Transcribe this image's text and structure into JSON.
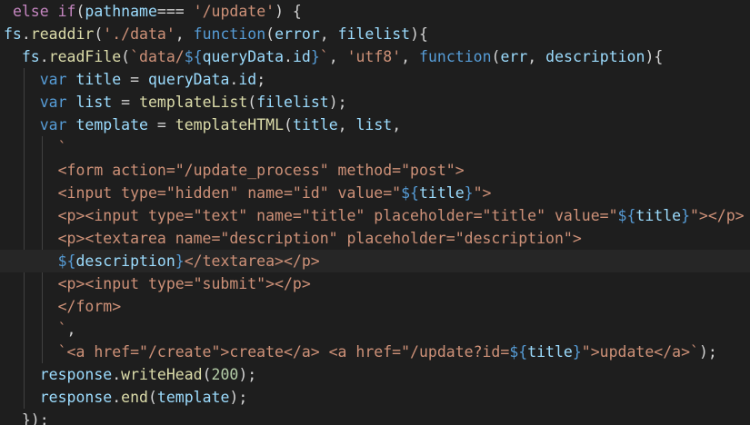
{
  "theme": {
    "background": "#1e1e1e",
    "current_line": "#262626",
    "indent_guide": "#404040",
    "colors": {
      "keyword": "#c586c0",
      "storage": "#569cd6",
      "function": "#dcdcaa",
      "variable": "#9cdcfe",
      "string": "#ce9178",
      "number": "#b5cea8",
      "punctuation": "#d4d4d4"
    }
  },
  "lines": [
    [
      [
        "pn",
        " "
      ],
      [
        "kw",
        "else if"
      ],
      [
        "pn",
        "("
      ],
      [
        "vr",
        "pathname"
      ],
      [
        "pn",
        "=== "
      ],
      [
        "str",
        "'/update'"
      ],
      [
        "pn",
        ") {"
      ]
    ],
    [
      [
        "vr",
        "fs"
      ],
      [
        "pn",
        "."
      ],
      [
        "fn",
        "readdir"
      ],
      [
        "pn",
        "("
      ],
      [
        "str",
        "'./data'"
      ],
      [
        "pn",
        ", "
      ],
      [
        "st",
        "function"
      ],
      [
        "pn",
        "("
      ],
      [
        "vr",
        "error"
      ],
      [
        "pn",
        ", "
      ],
      [
        "vr",
        "filelist"
      ],
      [
        "pn",
        "){"
      ]
    ],
    [
      [
        "pn",
        "  "
      ],
      [
        "vr",
        "fs"
      ],
      [
        "pn",
        "."
      ],
      [
        "fn",
        "readFile"
      ],
      [
        "pn",
        "("
      ],
      [
        "str",
        "`data/"
      ],
      [
        "tpl",
        "${"
      ],
      [
        "vr",
        "queryData"
      ],
      [
        "pn",
        "."
      ],
      [
        "vr",
        "id"
      ],
      [
        "tpl",
        "}"
      ],
      [
        "str",
        "`"
      ],
      [
        "pn",
        ", "
      ],
      [
        "str",
        "'utf8'"
      ],
      [
        "pn",
        ", "
      ],
      [
        "st",
        "function"
      ],
      [
        "pn",
        "("
      ],
      [
        "vr",
        "err"
      ],
      [
        "pn",
        ", "
      ],
      [
        "vr",
        "description"
      ],
      [
        "pn",
        "){"
      ]
    ],
    [
      [
        "pn",
        "    "
      ],
      [
        "st",
        "var"
      ],
      [
        "pn",
        " "
      ],
      [
        "vr",
        "title"
      ],
      [
        "pn",
        " = "
      ],
      [
        "vr",
        "queryData"
      ],
      [
        "pn",
        "."
      ],
      [
        "vr",
        "id"
      ],
      [
        "pn",
        ";"
      ]
    ],
    [
      [
        "pn",
        "    "
      ],
      [
        "st",
        "var"
      ],
      [
        "pn",
        " "
      ],
      [
        "vr",
        "list"
      ],
      [
        "pn",
        " = "
      ],
      [
        "fn",
        "templateList"
      ],
      [
        "pn",
        "("
      ],
      [
        "vr",
        "filelist"
      ],
      [
        "pn",
        ");"
      ]
    ],
    [
      [
        "pn",
        "    "
      ],
      [
        "st",
        "var"
      ],
      [
        "pn",
        " "
      ],
      [
        "vr",
        "template"
      ],
      [
        "pn",
        " = "
      ],
      [
        "fn",
        "templateHTML"
      ],
      [
        "pn",
        "("
      ],
      [
        "vr",
        "title"
      ],
      [
        "pn",
        ", "
      ],
      [
        "vr",
        "list"
      ],
      [
        "pn",
        ","
      ]
    ],
    [
      [
        "pn",
        "      "
      ],
      [
        "str",
        "`"
      ]
    ],
    [
      [
        "pn",
        "      "
      ],
      [
        "str",
        "<form action=\"/update_process\" method=\"post\">"
      ]
    ],
    [
      [
        "pn",
        "      "
      ],
      [
        "str",
        "<input type=\"hidden\" name=\"id\" value=\""
      ],
      [
        "tpl",
        "${"
      ],
      [
        "vr",
        "title"
      ],
      [
        "tpl",
        "}"
      ],
      [
        "str",
        "\">"
      ]
    ],
    [
      [
        "pn",
        "      "
      ],
      [
        "str",
        "<p><input type=\"text\" name=\"title\" placeholder=\"title\" value=\""
      ],
      [
        "tpl",
        "${"
      ],
      [
        "vr",
        "title"
      ],
      [
        "tpl",
        "}"
      ],
      [
        "str",
        "\"></p>"
      ]
    ],
    [
      [
        "pn",
        "      "
      ],
      [
        "str",
        "<p><textarea name=\"description\" placeholder=\"description\">"
      ]
    ],
    [
      [
        "pn",
        "      "
      ],
      [
        "tpl",
        "${"
      ],
      [
        "vr",
        "description"
      ],
      [
        "tpl",
        "}"
      ],
      [
        "str",
        "</textarea></p>"
      ]
    ],
    [
      [
        "pn",
        "      "
      ],
      [
        "str",
        "<p><input type=\"submit\"></p>"
      ]
    ],
    [
      [
        "pn",
        "      "
      ],
      [
        "str",
        "</form>"
      ]
    ],
    [
      [
        "pn",
        "      "
      ],
      [
        "str",
        "`"
      ],
      [
        "pn",
        ","
      ]
    ],
    [
      [
        "pn",
        "      "
      ],
      [
        "str",
        "`<a href=\"/create\">create</a> <a href=\"/update?id="
      ],
      [
        "tpl",
        "${"
      ],
      [
        "vr",
        "title"
      ],
      [
        "tpl",
        "}"
      ],
      [
        "str",
        "\">update</a>`"
      ],
      [
        "pn",
        ");"
      ]
    ],
    [
      [
        "pn",
        "    "
      ],
      [
        "vr",
        "response"
      ],
      [
        "pn",
        "."
      ],
      [
        "fn",
        "writeHead"
      ],
      [
        "pn",
        "("
      ],
      [
        "num",
        "200"
      ],
      [
        "pn",
        ");"
      ]
    ],
    [
      [
        "pn",
        "    "
      ],
      [
        "vr",
        "response"
      ],
      [
        "pn",
        "."
      ],
      [
        "fn",
        "end"
      ],
      [
        "pn",
        "("
      ],
      [
        "vr",
        "template"
      ],
      [
        "pn",
        ");"
      ]
    ],
    [
      [
        "pn",
        "  "
      ],
      [
        "pn",
        "});"
      ]
    ]
  ],
  "active_line": 11
}
